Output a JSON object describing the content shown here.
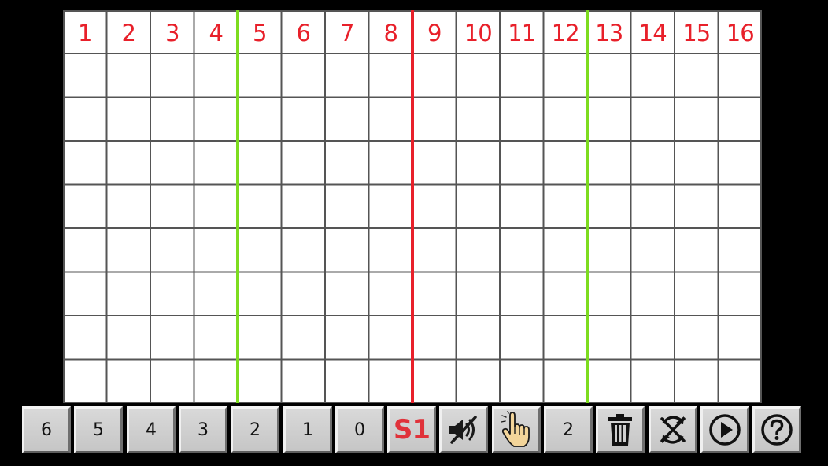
{
  "grid": {
    "columns": [
      "1",
      "2",
      "3",
      "4",
      "5",
      "6",
      "7",
      "8",
      "9",
      "10",
      "11",
      "12",
      "13",
      "14",
      "15",
      "16"
    ],
    "rows": 8,
    "header_color": "#e8202a",
    "bar_line_color": "#e8202a",
    "beat_line_color": "#7ddc1f",
    "line_color": "#555555"
  },
  "toolbar": {
    "buttons": [
      {
        "id": "note-6",
        "label": "6",
        "icon": null
      },
      {
        "id": "note-5",
        "label": "5",
        "icon": null
      },
      {
        "id": "note-4",
        "label": "4",
        "icon": null
      },
      {
        "id": "note-3",
        "label": "3",
        "icon": null
      },
      {
        "id": "note-2",
        "label": "2",
        "icon": null
      },
      {
        "id": "note-1",
        "label": "1",
        "icon": null
      },
      {
        "id": "note-0",
        "label": "0",
        "icon": null
      },
      {
        "id": "sound-set",
        "label": "S1",
        "icon": null
      },
      {
        "id": "mute",
        "label": "",
        "icon": "speaker-mute-icon"
      },
      {
        "id": "touch-mode",
        "label": "",
        "icon": "hand-pointer-icon"
      },
      {
        "id": "bar-count",
        "label": "2",
        "icon": null
      },
      {
        "id": "delete",
        "label": "",
        "icon": "trash-icon"
      },
      {
        "id": "sync-off",
        "label": "",
        "icon": "sync-off-icon"
      },
      {
        "id": "play",
        "label": "",
        "icon": "play-icon"
      },
      {
        "id": "help",
        "label": "",
        "icon": "help-icon"
      }
    ]
  }
}
